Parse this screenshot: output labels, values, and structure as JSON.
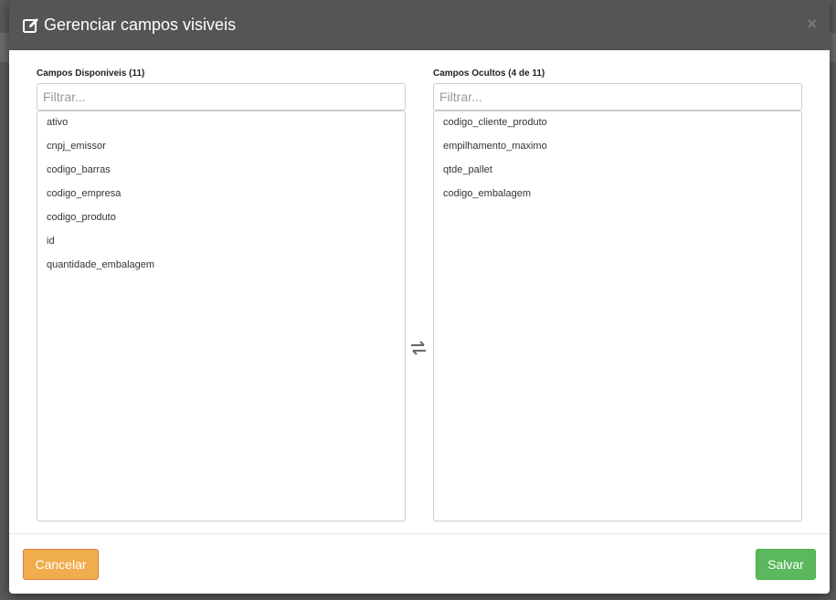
{
  "header": {
    "title": "Gerenciar campos visiveis",
    "title_icon": "edit-icon",
    "close_label": "×"
  },
  "available": {
    "label": "Campos Disponiveis (11)",
    "filter_placeholder": "Filtrar...",
    "items": [
      "ativo",
      "cnpj_emissor",
      "codigo_barras",
      "codigo_empresa",
      "codigo_produto",
      "id",
      "quantidade_embalagem"
    ]
  },
  "hidden": {
    "label": "Campos Ocultos (4 de 11)",
    "filter_placeholder": "Filtrar...",
    "items": [
      "codigo_cliente_produto",
      "empilhamento_maximo",
      "qtde_pallet",
      "codigo_embalagem"
    ]
  },
  "swap_icon": "swap-arrows-icon",
  "footer": {
    "cancel_label": "Cancelar",
    "save_label": "Salvar"
  },
  "colors": {
    "header_bg": "#555555",
    "cancel_bg": "#f0ad4e",
    "save_bg": "#5cb85c"
  }
}
